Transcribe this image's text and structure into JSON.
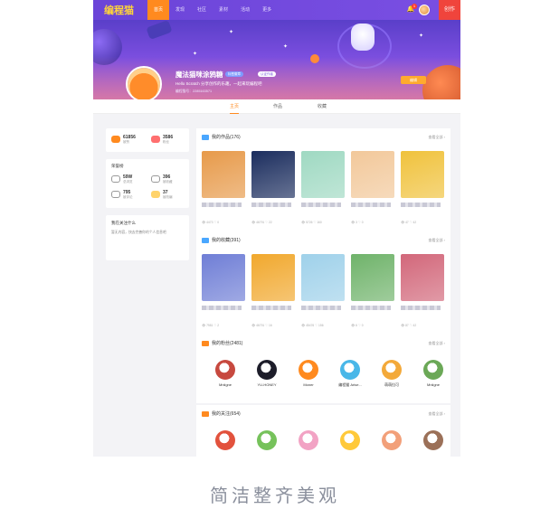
{
  "nav": {
    "logo": "编程猫",
    "tabs": [
      "首页",
      "发现",
      "社区",
      "素材",
      "活动",
      "更多"
    ],
    "notification_count": "1",
    "create_label": "创作"
  },
  "profile": {
    "name": "魔法猫咪涂鸦糖",
    "tags": [
      "标签徽章",
      "认证作者"
    ],
    "bio": "Hello Scratch 分享创作的乐趣，一起来玩编程吧",
    "uid": "编程猫号：2285163571",
    "edit_label": "编辑"
  },
  "subtabs": [
    "主页",
    "作品",
    "收藏"
  ],
  "stats": {
    "top": [
      {
        "value": "61856",
        "label": "被赞"
      },
      {
        "value": "3586",
        "label": "粉丝"
      }
    ],
    "honor_title": "荣誉榜",
    "honor": [
      {
        "value": "59W",
        "label": "总浏览"
      },
      {
        "value": "396",
        "label": "被收藏"
      },
      {
        "value": "795",
        "label": "被评论"
      },
      {
        "value": "37",
        "label": "被改编"
      }
    ],
    "intro_title": "我在关注什么",
    "intro_text": "暂无内容，快去完善你的个人信息吧"
  },
  "works": {
    "title": "我的作品(176)",
    "more": "查看全部 ›",
    "items": [
      {
        "color": "#e79a4a",
        "views": "4473",
        "likes": "0"
      },
      {
        "color": "#1b2d5e",
        "views": "46791",
        "likes": "22"
      },
      {
        "color": "#9fd9c2",
        "views": "5726",
        "likes": "160"
      },
      {
        "color": "#f2c89a",
        "views": "3",
        "likes": "0"
      },
      {
        "color": "#f0c23c",
        "views": "47",
        "likes": "42"
      }
    ]
  },
  "favorites": {
    "title": "我的收藏(391)",
    "more": "查看全部 ›",
    "items": [
      {
        "color": "#6f7ed6",
        "views": "7981",
        "likes": "2"
      },
      {
        "color": "#f1a82d",
        "views": "46791",
        "likes": "16"
      },
      {
        "color": "#9fd1ea",
        "views": "45476",
        "likes": "156"
      },
      {
        "color": "#6fb36a",
        "views": "6",
        "likes": "0"
      },
      {
        "color": "#d2677a",
        "views": "87",
        "likes": "42"
      }
    ]
  },
  "fans": {
    "title": "我的粉丝(2481)",
    "more": "查看全部 ›",
    "users": [
      {
        "name": "Mniigne",
        "color": "#c7493f"
      },
      {
        "name": "YU-HONEY",
        "color": "#1d1d2a"
      },
      {
        "name": "Moner",
        "color": "#ff8a1f"
      },
      {
        "name": "编程猫 Arise...",
        "color": "#49b7e8"
      },
      {
        "name": "萌萌拉可",
        "color": "#f3a93a"
      },
      {
        "name": "Mniigne",
        "color": "#6ba857"
      }
    ]
  },
  "following": {
    "title": "我的关注(654)",
    "more": "查看全部 ›",
    "users": [
      {
        "color": "#e2523d"
      },
      {
        "color": "#76c25b"
      },
      {
        "color": "#f2a3c4"
      },
      {
        "color": "#ffc93a"
      },
      {
        "color": "#f2a07a"
      },
      {
        "color": "#9b7058"
      }
    ]
  },
  "caption": "简洁整齐美观"
}
